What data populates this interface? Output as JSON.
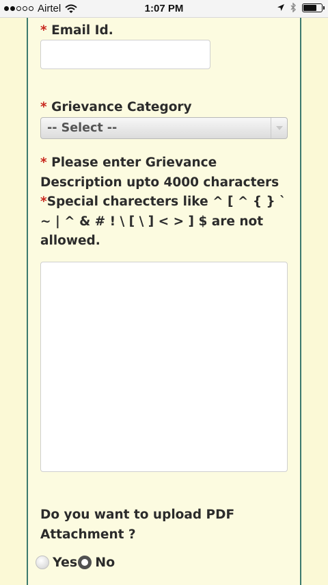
{
  "status_bar": {
    "carrier": "Airtel",
    "time": "1:07 PM",
    "signal_strength_bars": 2,
    "signal_total_bars": 5,
    "battery_level": 0.72
  },
  "form": {
    "email": {
      "required_marker": "*",
      "label": "Email Id.",
      "value": ""
    },
    "grievance_category": {
      "required_marker": "*",
      "label": "Grievance Category",
      "selected": "-- Select --"
    },
    "description": {
      "required_marker": "*",
      "label_line": "Please enter Grievance Description upto 4000 characters",
      "special_marker": "*",
      "special_text": "Special charecters like ^ [ ^ { } ` ~ | ^ & # ! \\ [ \\ ] < > ] $ are not allowed.",
      "value": ""
    },
    "upload_question": "Do you want to upload PDF Attachment ?",
    "upload_options": [
      {
        "label": "Yes",
        "selected": false
      },
      {
        "label": "No",
        "selected": true
      }
    ]
  },
  "colors": {
    "page_bg": "#fbf9d6",
    "panel_border": "#3c7a6e",
    "required": "#c8271d"
  }
}
